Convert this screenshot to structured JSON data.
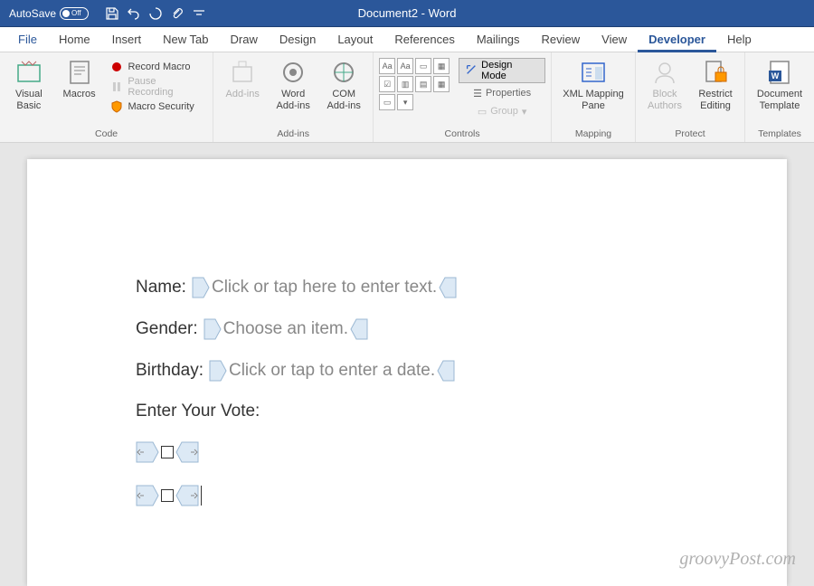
{
  "titlebar": {
    "autosave_label": "AutoSave",
    "autosave_state": "Off",
    "document_title": "Document2 - Word"
  },
  "tabs": {
    "file": "File",
    "items": [
      "Home",
      "Insert",
      "New Tab",
      "Draw",
      "Design",
      "Layout",
      "References",
      "Mailings",
      "Review",
      "View",
      "Developer",
      "Help"
    ],
    "active": "Developer"
  },
  "ribbon": {
    "code": {
      "title": "Code",
      "visual_basic": "Visual Basic",
      "macros": "Macros",
      "record_macro": "Record Macro",
      "pause_recording": "Pause Recording",
      "macro_security": "Macro Security"
    },
    "addins": {
      "title": "Add-ins",
      "addins": "Add-ins",
      "word_addins": "Word Add-ins",
      "com_addins": "COM Add-ins"
    },
    "controls": {
      "title": "Controls",
      "design_mode": "Design Mode",
      "properties": "Properties",
      "group": "Group"
    },
    "mapping": {
      "title": "Mapping",
      "xml_mapping": "XML Mapping Pane"
    },
    "protect": {
      "title": "Protect",
      "block_authors": "Block Authors",
      "restrict_editing": "Restrict Editing"
    },
    "templates": {
      "title": "Templates",
      "document_template": "Document Template"
    }
  },
  "document": {
    "fields": {
      "name_label": "Name:",
      "name_placeholder": "Click or tap here to enter text.",
      "gender_label": "Gender:",
      "gender_placeholder": "Choose an item.",
      "birthday_label": "Birthday:",
      "birthday_placeholder": "Click or tap to enter a date.",
      "vote_label": "Enter Your Vote:"
    }
  },
  "watermark": "groovyPost.com"
}
